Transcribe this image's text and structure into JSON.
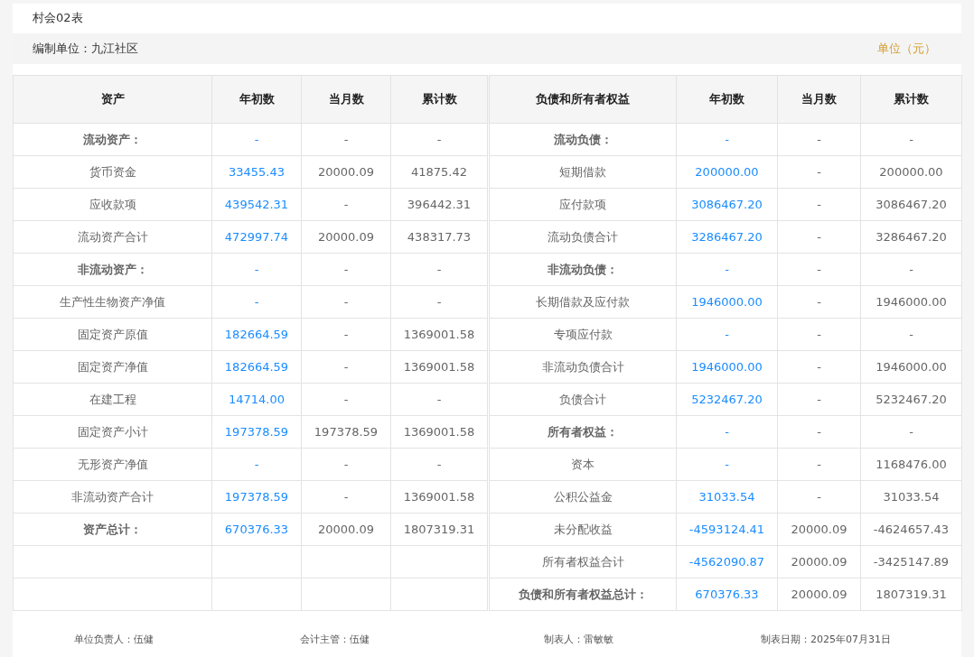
{
  "title": "村会02表",
  "unit_bar": {
    "org": "编制单位：九江社区",
    "unit": "单位（元）"
  },
  "columns_left": [
    "资产",
    "年初数",
    "当月数",
    "累计数"
  ],
  "columns_right": [
    "负债和所有者权益",
    "年初数",
    "当月数",
    "累计数"
  ],
  "rows": [
    {
      "left": {
        "kind": "heading",
        "label": "流动资产：",
        "values": [
          "-",
          "-",
          "-"
        ]
      },
      "right": {
        "kind": "heading",
        "label": "流动负债：",
        "values": [
          "-",
          "-",
          "-"
        ]
      }
    },
    {
      "left": {
        "kind": "item",
        "label": "货币资金",
        "values": [
          "33455.43",
          "20000.09",
          "41875.42"
        ]
      },
      "right": {
        "kind": "item",
        "label": "短期借款",
        "values": [
          "200000.00",
          "-",
          "200000.00"
        ]
      }
    },
    {
      "left": {
        "kind": "item",
        "label": "应收款项",
        "values": [
          "439542.31",
          "-",
          "396442.31"
        ]
      },
      "right": {
        "kind": "item",
        "label": "应付款项",
        "values": [
          "3086467.20",
          "-",
          "3086467.20"
        ]
      }
    },
    {
      "left": {
        "kind": "item",
        "label": "流动资产合计",
        "values": [
          "472997.74",
          "20000.09",
          "438317.73"
        ]
      },
      "right": {
        "kind": "item",
        "label": "流动负债合计",
        "values": [
          "3286467.20",
          "-",
          "3286467.20"
        ]
      }
    },
    {
      "left": {
        "kind": "heading",
        "label": "非流动资产：",
        "values": [
          "-",
          "-",
          "-"
        ]
      },
      "right": {
        "kind": "heading",
        "label": "非流动负债：",
        "values": [
          "-",
          "-",
          "-"
        ]
      }
    },
    {
      "left": {
        "kind": "item",
        "label": "生产性生物资产净值",
        "values": [
          "-",
          "-",
          "-"
        ]
      },
      "right": {
        "kind": "item",
        "label": "长期借款及应付款",
        "values": [
          "1946000.00",
          "-",
          "1946000.00"
        ]
      }
    },
    {
      "left": {
        "kind": "item",
        "label": "固定资产原值",
        "values": [
          "182664.59",
          "-",
          "1369001.58"
        ]
      },
      "right": {
        "kind": "item",
        "label": "专项应付款",
        "values": [
          "-",
          "-",
          "-"
        ]
      }
    },
    {
      "left": {
        "kind": "item",
        "label": "固定资产净值",
        "values": [
          "182664.59",
          "-",
          "1369001.58"
        ]
      },
      "right": {
        "kind": "item",
        "label": "非流动负债合计",
        "values": [
          "1946000.00",
          "-",
          "1946000.00"
        ]
      }
    },
    {
      "left": {
        "kind": "item",
        "label": "在建工程",
        "values": [
          "14714.00",
          "-",
          "-"
        ]
      },
      "right": {
        "kind": "item",
        "label": "负债合计",
        "values": [
          "5232467.20",
          "-",
          "5232467.20"
        ]
      }
    },
    {
      "left": {
        "kind": "item",
        "label": "固定资产小计",
        "values": [
          "197378.59",
          "197378.59",
          "1369001.58"
        ]
      },
      "right": {
        "kind": "heading",
        "label": "所有者权益：",
        "values": [
          "-",
          "-",
          "-"
        ]
      }
    },
    {
      "left": {
        "kind": "item",
        "label": "无形资产净值",
        "values": [
          "-",
          "-",
          "-"
        ]
      },
      "right": {
        "kind": "item",
        "label": "资本",
        "values": [
          "-",
          "-",
          "1168476.00"
        ]
      }
    },
    {
      "left": {
        "kind": "item",
        "label": "非流动资产合计",
        "values": [
          "197378.59",
          "-",
          "1369001.58"
        ]
      },
      "right": {
        "kind": "item",
        "label": "公积公益金",
        "values": [
          "31033.54",
          "-",
          "31033.54"
        ]
      }
    },
    {
      "left": {
        "kind": "heading",
        "label": "资产总计：",
        "values": [
          "670376.33",
          "20000.09",
          "1807319.31"
        ]
      },
      "right": {
        "kind": "item",
        "label": "未分配收益",
        "values": [
          "-4593124.41",
          "20000.09",
          "-4624657.43"
        ]
      }
    },
    {
      "right": {
        "kind": "item",
        "label": "所有者权益合计",
        "values": [
          "-4562090.87",
          "20000.09",
          "-3425147.89"
        ]
      }
    },
    {
      "right": {
        "kind": "heading",
        "label": "负债和所有者权益总计：",
        "values": [
          "670376.33",
          "20000.09",
          "1807319.31"
        ]
      }
    }
  ],
  "footer": [
    "单位负责人：伍健",
    "会计主管：伍健",
    "制表人：雷敏敏",
    "制表日期：2025年07月31日"
  ]
}
